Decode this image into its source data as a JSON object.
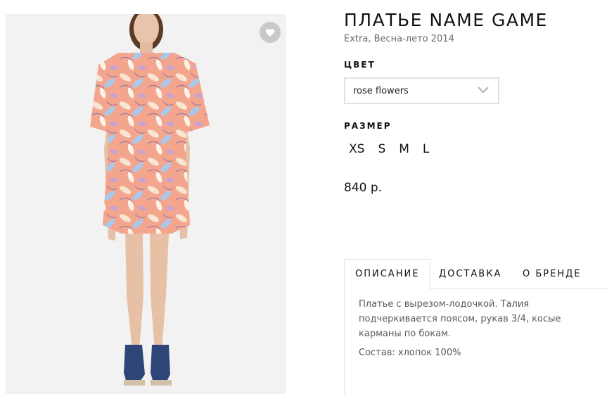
{
  "product": {
    "title": "ПЛАТЬЕ NAME GAME",
    "subtitle": "Extra, Весна-лето 2014",
    "image_alt": "favorite-heart-icon"
  },
  "color": {
    "label": "ЦВЕТ",
    "selected": "rose flowers",
    "icon": "chevron-down-icon"
  },
  "size": {
    "label": "РАЗМЕР",
    "options": [
      "XS",
      "S",
      "M",
      "L"
    ]
  },
  "price": "840 р.",
  "tabs": {
    "items": [
      {
        "label": "ОПИСАНИЕ"
      },
      {
        "label": "ДОСТАВКА"
      },
      {
        "label": "О БРЕНДЕ"
      }
    ],
    "active": "ОПИСАНИЕ",
    "description": "Платье с вырезом-лодочкой. Талия подчеркивается поясом, рукав 3/4, косые карманы по бокам.",
    "composition": "Состав: хлопок 100%"
  },
  "colors": {
    "accent": "#111111",
    "border": "#e2e2e2",
    "muted": "#6a6a6a",
    "fav_bg": "#c9c9c9"
  }
}
